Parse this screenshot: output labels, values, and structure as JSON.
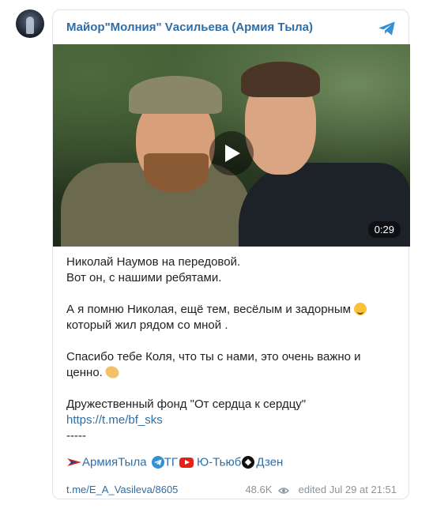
{
  "channel": {
    "title": "Майор\"Молния\" Vасильева (Армия Тыла)"
  },
  "video": {
    "duration": "0:29"
  },
  "message": {
    "line1": "Николай Наумов на передовой.",
    "line2": "Вот он, с нашими ребятами.",
    "line3": "А я помню Николая, ещё тем, весёлым и задорным",
    "line4": "который жил рядом со мной .",
    "line5": "Спасибо тебе Коля, что ты с нами, это очень важно и",
    "line6": "ценно.",
    "line7": "Дружественный фонд \"От сердца к сердцу\"",
    "link": "https://t.me/bf_sks",
    "separator": "-----"
  },
  "social": {
    "army": "АрмияТыла",
    "tg": "ТГ",
    "youtube": "Ю-Тьюб",
    "dzen": "Дзен"
  },
  "footer": {
    "post_link": "t.me/E_A_Vasileva/8605",
    "views": "48.6K",
    "edited": "edited  Jul 29 at 21:51"
  },
  "icons": {
    "telegram_color": "#3390d6",
    "link_color": "#2f6ea5"
  }
}
